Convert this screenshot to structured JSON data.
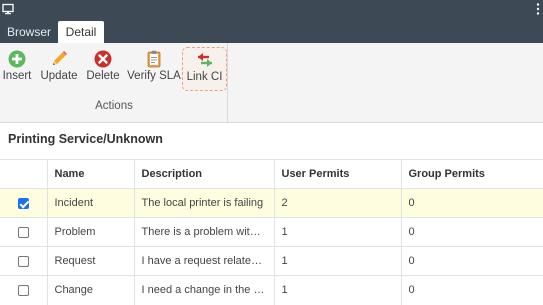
{
  "tabs": [
    {
      "label": "Browser",
      "active": false
    },
    {
      "label": "Detail",
      "active": true
    }
  ],
  "ribbon": {
    "buttons": [
      {
        "label": "Insert",
        "icon": "plus-circle-icon",
        "color": "#4caf50"
      },
      {
        "label": "Update",
        "icon": "pencil-icon",
        "color": "#f0a030"
      },
      {
        "label": "Delete",
        "icon": "delete-x-icon",
        "color": "#c62828"
      },
      {
        "label": "Verify SLA",
        "icon": "clipboard-icon",
        "color": "#e8a040"
      },
      {
        "label": "Link CI",
        "icon": "link-arrows-icon",
        "color": "#c62828"
      }
    ],
    "group_label": "Actions"
  },
  "page_title": "Printing Service/Unknown",
  "table": {
    "columns": [
      "Name",
      "Description",
      "User Permits",
      "Group Permits"
    ],
    "rows": [
      {
        "checked": true,
        "name": "Incident",
        "description": "The local printer is failing",
        "user_permits": "2",
        "group_permits": "0"
      },
      {
        "checked": false,
        "name": "Problem",
        "description": "There is a problem with the l...",
        "user_permits": "1",
        "group_permits": "0"
      },
      {
        "checked": false,
        "name": "Request",
        "description": "I have a request related to th...",
        "user_permits": "1",
        "group_permits": "0"
      },
      {
        "checked": false,
        "name": "Change",
        "description": "I need a change in the local p...",
        "user_permits": "1",
        "group_permits": "0"
      }
    ]
  },
  "colors": {
    "header_bg": "#3d4a55",
    "selected_row": "#fffde0",
    "checkbox_accent": "#1a73e8",
    "highlight_border": "#f0a07a"
  }
}
